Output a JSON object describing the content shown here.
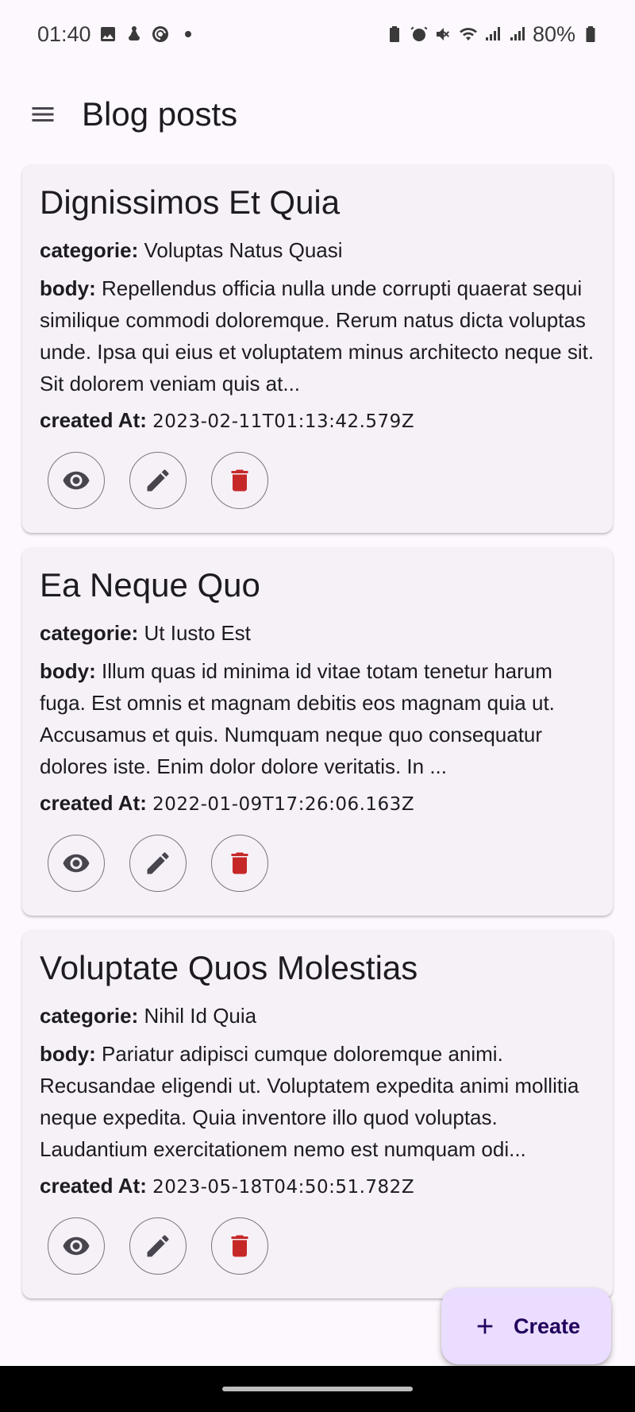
{
  "status_bar": {
    "time": "01:40",
    "battery": "80%",
    "left_icons": [
      "image-icon",
      "lab-icon",
      "face-icon"
    ],
    "right_icons": [
      "battery-saver-icon",
      "alarm-icon",
      "mute-icon",
      "wifi-icon",
      "signal-icon",
      "signal-icon",
      "battery-icon"
    ]
  },
  "app_bar": {
    "title": "Blog posts"
  },
  "labels": {
    "category": "categorie:",
    "body": "body:",
    "created": "created At:"
  },
  "posts": [
    {
      "title": "Dignissimos Et Quia",
      "category": "Voluptas Natus Quasi",
      "body": "Repellendus officia nulla unde corrupti quaerat sequi similique commodi doloremque. Rerum natus dicta voluptas unde. Ipsa qui eius et voluptatem minus architecto neque sit. Sit dolorem veniam quis at...",
      "created_at": "2023-02-11T01:13:42.579Z"
    },
    {
      "title": "Ea Neque Quo",
      "category": "Ut Iusto Est",
      "body": "Illum quas id minima id vitae totam tenetur harum fuga. Est omnis et magnam debitis eos magnam quia ut. Accusamus et quis. Numquam neque quo consequatur dolores iste. Enim dolor dolore veritatis. In ...",
      "created_at": "2022-01-09T17:26:06.163Z"
    },
    {
      "title": "Voluptate Quos Molestias",
      "category": "Nihil Id Quia",
      "body": "Pariatur adipisci cumque doloremque animi. Recusandae eligendi ut. Voluptatem expedita animi mollitia neque expedita. Quia inventore illo quod voluptas. Laudantium exercitationem nemo est numquam odi...",
      "created_at": "2023-05-18T04:50:51.782Z"
    }
  ],
  "fab": {
    "label": "Create"
  },
  "colors": {
    "delete": "#c62828",
    "icon": "#49454f",
    "fab_bg": "#eaddff",
    "card_bg": "#f6f1f7"
  }
}
